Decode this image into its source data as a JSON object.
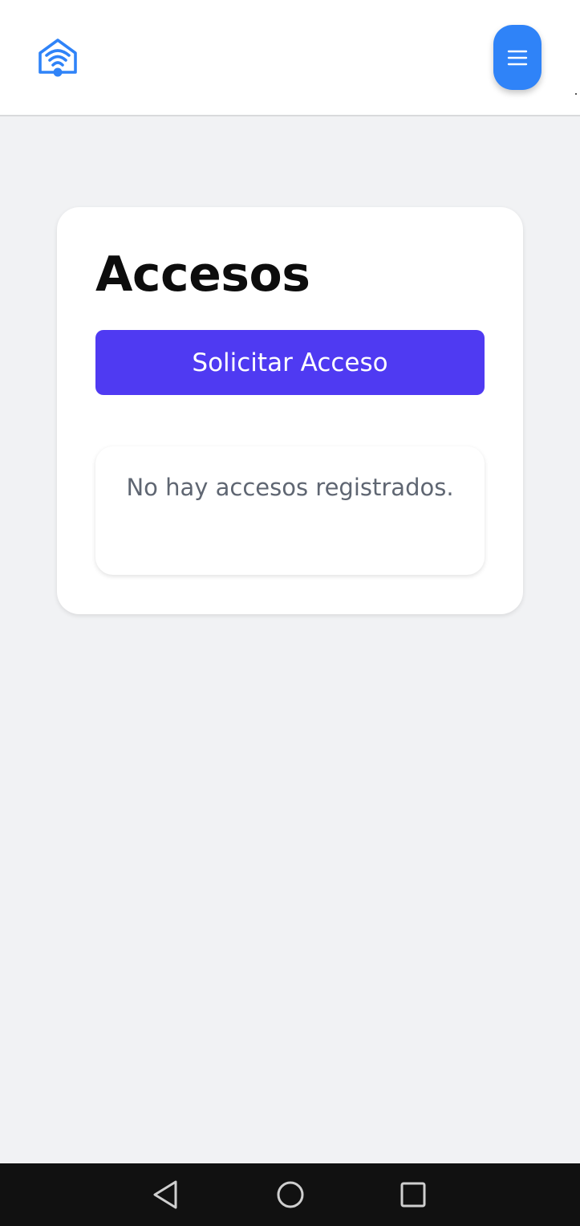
{
  "header": {
    "logo_icon": "home-wifi-icon",
    "menu_icon": "hamburger-menu-icon",
    "accent_color": "#2f83f8"
  },
  "main": {
    "title": "Accesos",
    "request_button_label": "Solicitar Acceso",
    "request_button_color": "#4f3af2",
    "empty_message": "No hay accesos registrados."
  },
  "system_nav": {
    "back_icon": "back-triangle-icon",
    "home_icon": "home-circle-icon",
    "recents_icon": "recents-square-icon"
  }
}
